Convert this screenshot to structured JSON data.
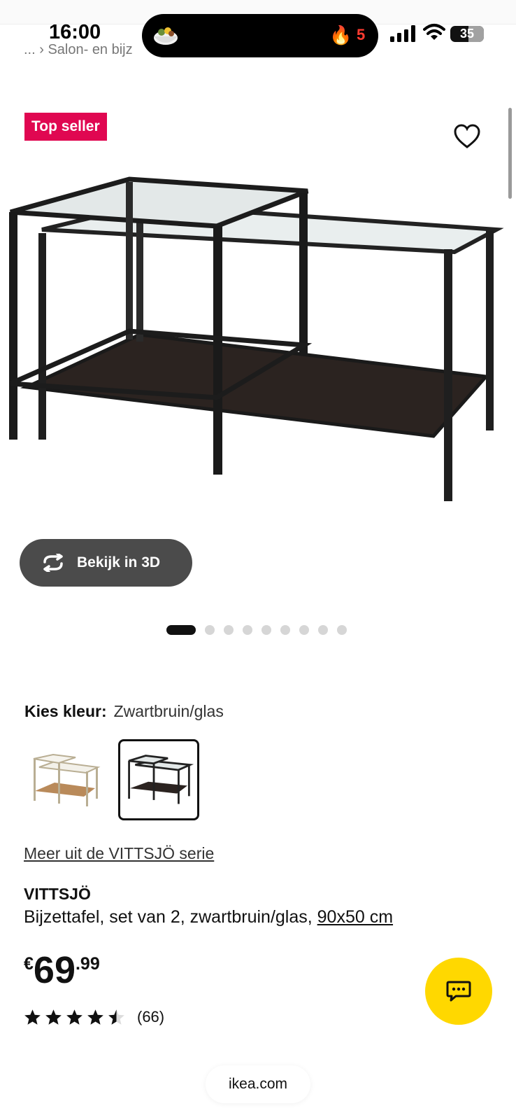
{
  "status_bar": {
    "time": "16:00",
    "island_count": "5",
    "battery": "35"
  },
  "breadcrumb": "... › Salon- en bijz",
  "badge": "Top seller",
  "view_3d_label": "Bekijk in 3D",
  "carousel": {
    "total": 9,
    "active": 1
  },
  "color": {
    "label": "Kies kleur:",
    "value": "Zwartbruin/glas"
  },
  "series_link": "Meer uit de VITTSJÖ serie",
  "product": {
    "name": "VITTSJÖ",
    "description": "Bijzettafel, set van 2, zwartbruin/glas,",
    "size": "90x50 cm",
    "price_currency": "€",
    "price_whole": "69",
    "price_decimal": ".99",
    "rating": 4.5,
    "review_count": "(66)"
  },
  "url": "ikea.com",
  "colors": {
    "brand_red": "#e00751",
    "chat_yellow": "#ffd800"
  }
}
